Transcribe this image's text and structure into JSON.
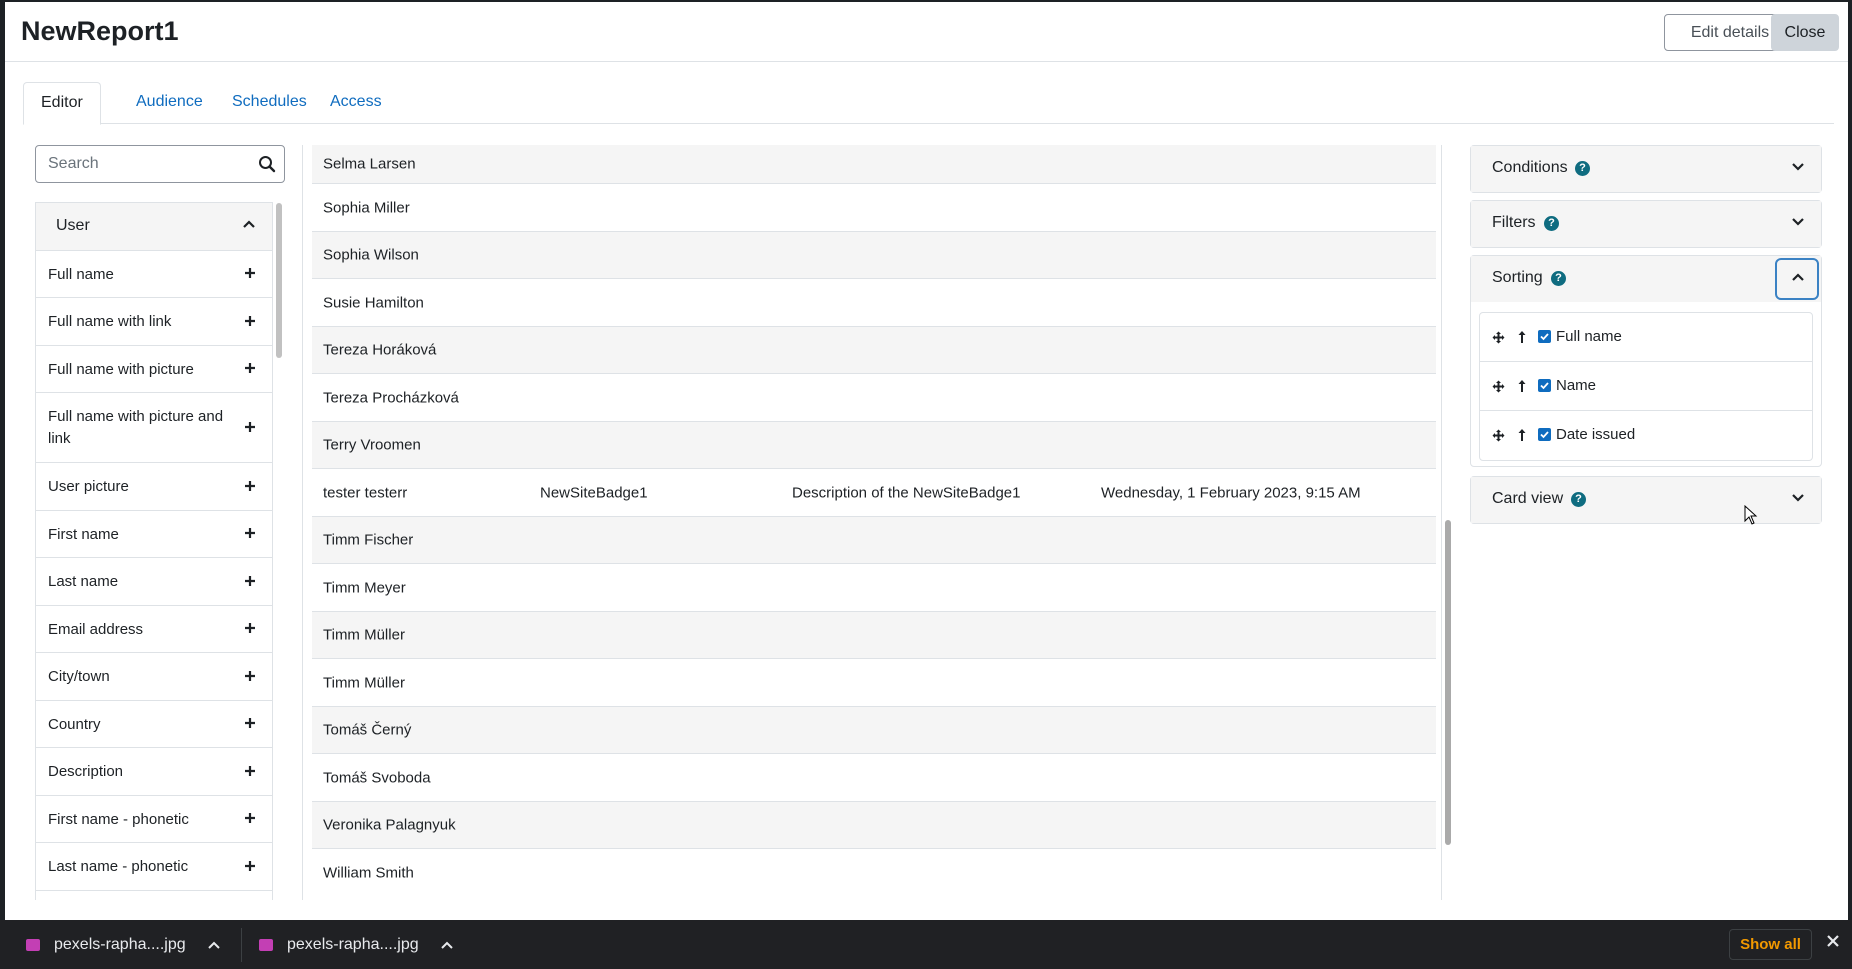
{
  "header": {
    "title": "NewReport1",
    "edit_label": "Edit details",
    "close_label": "Close"
  },
  "tabs": [
    {
      "label": "Editor",
      "active": true
    },
    {
      "label": "Audience"
    },
    {
      "label": "Schedules"
    },
    {
      "label": "Access"
    }
  ],
  "sidebar": {
    "search_placeholder": "Search",
    "group": "User",
    "items": [
      {
        "label": "Full name"
      },
      {
        "label": "Full name with link"
      },
      {
        "label": "Full name with picture"
      },
      {
        "label": "Full name with picture and link"
      },
      {
        "label": "User picture"
      },
      {
        "label": "First name"
      },
      {
        "label": "Last name"
      },
      {
        "label": "Email address"
      },
      {
        "label": "City/town"
      },
      {
        "label": "Country"
      },
      {
        "label": "Description"
      },
      {
        "label": "First name - phonetic"
      },
      {
        "label": "Last name - phonetic"
      }
    ]
  },
  "rows": [
    {
      "name": "Selma Larsen"
    },
    {
      "name": "Sophia Miller"
    },
    {
      "name": "Sophia Wilson"
    },
    {
      "name": "Susie Hamilton"
    },
    {
      "name": "Tereza Horáková"
    },
    {
      "name": "Tereza Procházková"
    },
    {
      "name": "Terry Vroomen"
    },
    {
      "name": "tester testerr",
      "badge": "NewSiteBadge1",
      "description": "Description of the NewSiteBadge1",
      "date": "Wednesday, 1 February 2023, 9:15 AM"
    },
    {
      "name": "Timm Fischer"
    },
    {
      "name": "Timm Meyer"
    },
    {
      "name": "Timm Müller"
    },
    {
      "name": "Timm Müller"
    },
    {
      "name": "Tomáš Černý"
    },
    {
      "name": "Tomáš Svoboda"
    },
    {
      "name": "Veronika Palagnyuk"
    },
    {
      "name": "William Smith"
    }
  ],
  "panels": {
    "conditions": "Conditions",
    "filters": "Filters",
    "sorting": "Sorting",
    "card_view": "Card view",
    "sort_items": [
      {
        "label": "Full name"
      },
      {
        "label": "Name"
      },
      {
        "label": "Date issued"
      }
    ]
  },
  "taskbar": {
    "downloads": [
      {
        "label": "pexels-rapha....jpg"
      },
      {
        "label": "pexels-rapha....jpg"
      }
    ],
    "show_all": "Show all"
  }
}
